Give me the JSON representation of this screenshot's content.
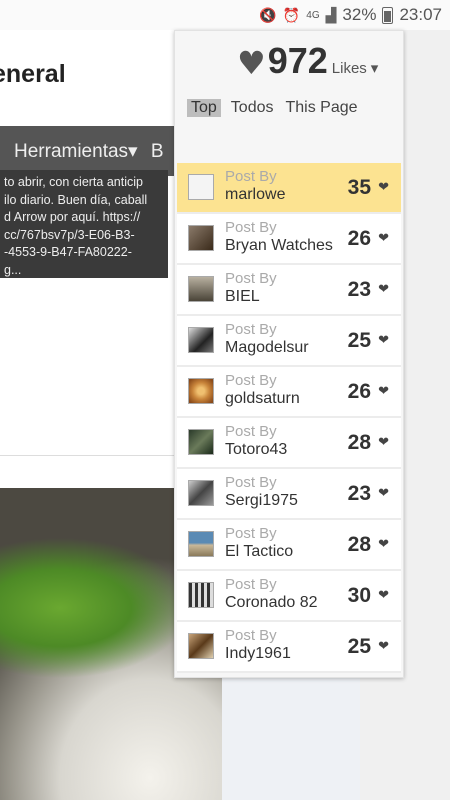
{
  "status_bar": {
    "network": "4G",
    "battery_percent": "32%",
    "time": "23:07"
  },
  "page": {
    "title": "eneral",
    "nav_tools": "Herramientas",
    "nav_next": "B",
    "tooltip_lines": [
      "to abrir, con cierta anticip",
      "ilo diario. Buen día, caball",
      "d Arrow por aquí. https://",
      "cc/767bsv7p/3-E06-B3-",
      "-4553-9-B47-FA80222-",
      "g..."
    ]
  },
  "likes_panel": {
    "total": "972",
    "label": "Likes",
    "tabs": [
      "Top",
      "Todos",
      "This Page"
    ],
    "active_tab": "Top",
    "post_by_label": "Post By",
    "rows": [
      {
        "author": "marlowe",
        "count": "35",
        "highlight": true,
        "thumb": "#f4f4f4"
      },
      {
        "author": "Bryan Watches",
        "count": "26",
        "thumb": "#5a4a3a"
      },
      {
        "author": "BIEL",
        "count": "23",
        "thumb": "#7a7468"
      },
      {
        "author": "Magodelsur",
        "count": "25",
        "thumb": "#2d2d2d"
      },
      {
        "author": "goldsaturn",
        "count": "26",
        "thumb": "#c8843a"
      },
      {
        "author": "Totoro43",
        "count": "28",
        "thumb": "#3a4a3a"
      },
      {
        "author": "Sergi1975",
        "count": "23",
        "thumb": "#6a6a6a"
      },
      {
        "author": "El Tactico",
        "count": "28",
        "thumb": "#5a8ab4"
      },
      {
        "author": "Coronado 82",
        "count": "30",
        "thumb": "#9a9a9a"
      },
      {
        "author": "Indy1961",
        "count": "25",
        "thumb": "#8a6a4a"
      }
    ]
  }
}
